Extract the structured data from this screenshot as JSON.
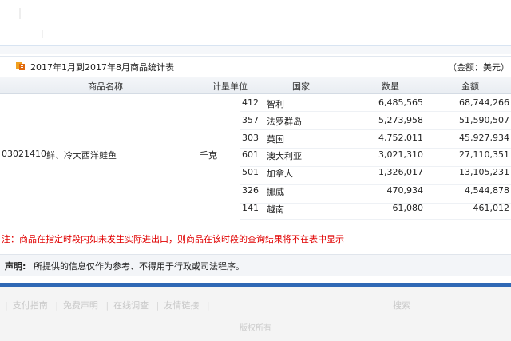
{
  "title": "2017年1月到2017年8月商品统计表",
  "unit_note": "（金额：美元）",
  "headers": {
    "name": "商品名称",
    "unit": "计量单位",
    "country": "国家",
    "qty": "数量",
    "amount": "金额"
  },
  "product": {
    "code": "03021410",
    "name": "鲜、冷大西洋鲑鱼",
    "unit": "千克"
  },
  "rows": [
    {
      "code": "412",
      "country": "智利",
      "qty": "6,485,565",
      "amount": "68,744,266"
    },
    {
      "code": "357",
      "country": "法罗群岛",
      "qty": "5,273,958",
      "amount": "51,590,507"
    },
    {
      "code": "303",
      "country": "英国",
      "qty": "4,752,011",
      "amount": "45,927,934"
    },
    {
      "code": "601",
      "country": "澳大利亚",
      "qty": "3,021,310",
      "amount": "27,110,351"
    },
    {
      "code": "501",
      "country": "加拿大",
      "qty": "1,326,017",
      "amount": "13,105,231"
    },
    {
      "code": "326",
      "country": "挪威",
      "qty": "470,934",
      "amount": "4,544,878"
    },
    {
      "code": "141",
      "country": "越南",
      "qty": "61,080",
      "amount": "461,012"
    }
  ],
  "note": "注：商品在指定时段内如未发生实际进出口，则商品在该时段的查询结果将不在表中显示",
  "statement": {
    "label": "声明:",
    "text": "所提供的信息仅作为参考、不得用于行政或司法程序。"
  },
  "footer": {
    "links": [
      "支付指南",
      "免费声明",
      "在线调查",
      "友情链接"
    ],
    "tail": "搜索",
    "bottom": "版权所有"
  }
}
